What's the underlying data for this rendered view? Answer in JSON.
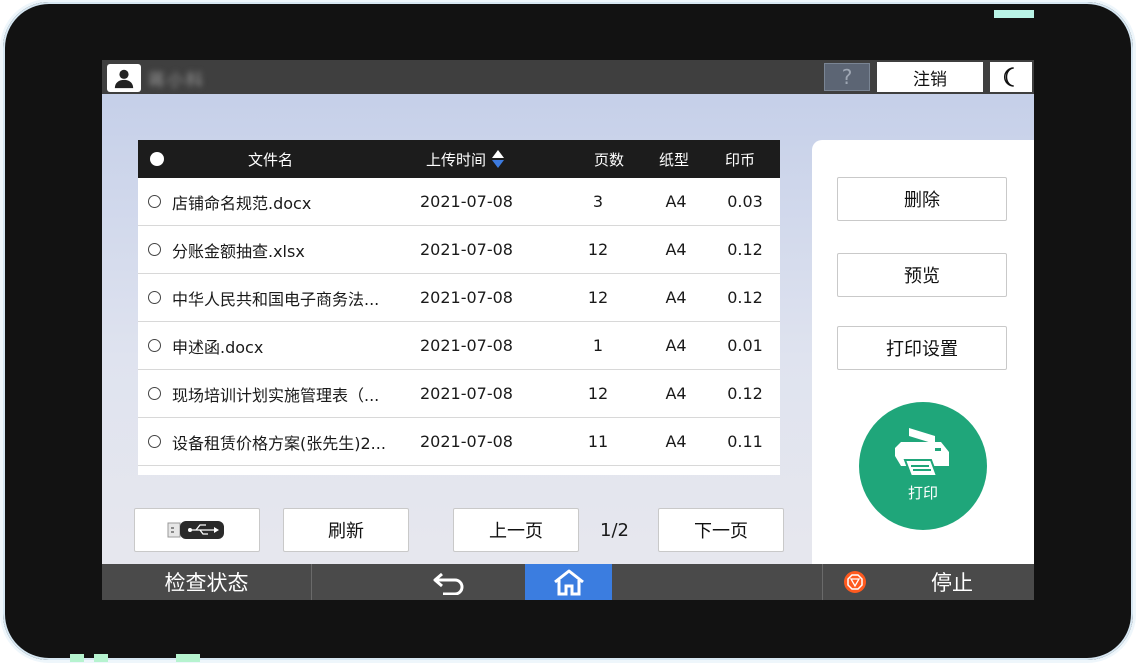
{
  "topbar": {
    "username": "蒋小科",
    "help_label": "?",
    "logout_label": "注销"
  },
  "table": {
    "headers": {
      "name": "文件名",
      "upload_time": "上传时间",
      "pages": "页数",
      "paper": "纸型",
      "coins": "印币"
    },
    "rows": [
      {
        "name": "店铺命名规范.docx",
        "time": "2021-07-08",
        "pages": "3",
        "paper": "A4",
        "coins": "0.03"
      },
      {
        "name": "分账金额抽查.xlsx",
        "time": "2021-07-08",
        "pages": "12",
        "paper": "A4",
        "coins": "0.12"
      },
      {
        "name": "中华人民共和国电子商务法...",
        "time": "2021-07-08",
        "pages": "12",
        "paper": "A4",
        "coins": "0.12"
      },
      {
        "name": "申述函.docx",
        "time": "2021-07-08",
        "pages": "1",
        "paper": "A4",
        "coins": "0.01"
      },
      {
        "name": "现场培训计划实施管理表（...",
        "time": "2021-07-08",
        "pages": "12",
        "paper": "A4",
        "coins": "0.12"
      },
      {
        "name": "设备租赁价格方案(张先生)2...",
        "time": "2021-07-08",
        "pages": "11",
        "paper": "A4",
        "coins": "0.11"
      }
    ]
  },
  "buttons": {
    "refresh": "刷新",
    "prev_page": "上一页",
    "next_page": "下一页",
    "page_indicator": "1/2"
  },
  "right_panel": {
    "delete": "删除",
    "preview": "预览",
    "print_settings": "打印设置",
    "print": "打印"
  },
  "bottombar": {
    "check_status": "检查状态",
    "stop": "停止"
  },
  "icons": {
    "user": "user-icon",
    "night_mode": "moon-icon",
    "usb": "usb-icon",
    "back": "back-arrow-icon",
    "home": "home-icon",
    "stop": "stop-icon",
    "printer": "printer-icon"
  },
  "colors": {
    "print_button": "#1fa67a",
    "home_active": "#3b7de0",
    "stop_icon": "#ff5a1f",
    "table_header": "#1c1c1c"
  }
}
